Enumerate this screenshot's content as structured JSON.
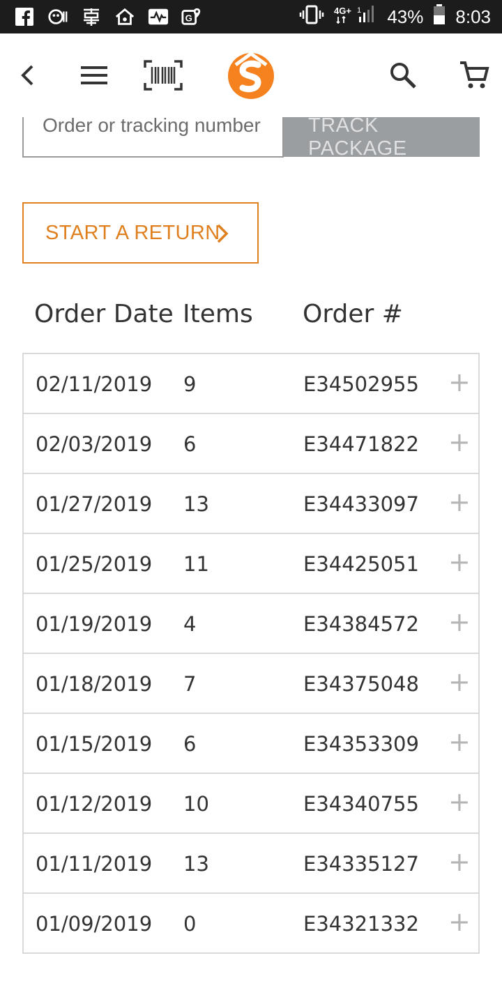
{
  "status_bar": {
    "battery_percent": "43%",
    "time": "8:03",
    "icons": [
      "facebook-icon",
      "app-icon",
      "app-icon-2",
      "home-icon",
      "activity-icon",
      "map-icon",
      "vibrate-icon",
      "signal-icon",
      "battery-icon"
    ]
  },
  "header": {
    "icons": [
      "back-arrow-icon",
      "menu-icon",
      "barcode-icon",
      "brand-logo",
      "search-icon",
      "cart-icon"
    ],
    "brand_color": "#f5821f"
  },
  "tracking": {
    "placeholder": "Order or tracking number",
    "button_label": "TRACK PACKAGE"
  },
  "return": {
    "label": "START A RETURN",
    "accent_color": "#e07f1e"
  },
  "orders_table": {
    "columns": [
      "Order Date",
      "Items",
      "Order #"
    ],
    "rows": [
      {
        "date": "02/11/2019",
        "items": "9",
        "order": "E34502955"
      },
      {
        "date": "02/03/2019",
        "items": "6",
        "order": "E34471822"
      },
      {
        "date": "01/27/2019",
        "items": "13",
        "order": "E34433097"
      },
      {
        "date": "01/25/2019",
        "items": "11",
        "order": "E34425051"
      },
      {
        "date": "01/19/2019",
        "items": "4",
        "order": "E34384572"
      },
      {
        "date": "01/18/2019",
        "items": "7",
        "order": "E34375048"
      },
      {
        "date": "01/15/2019",
        "items": "6",
        "order": "E34353309"
      },
      {
        "date": "01/12/2019",
        "items": "10",
        "order": "E34340755"
      },
      {
        "date": "01/11/2019",
        "items": "13",
        "order": "E34335127"
      },
      {
        "date": "01/09/2019",
        "items": "0",
        "order": "E34321332"
      }
    ],
    "expand_symbol": "+"
  }
}
